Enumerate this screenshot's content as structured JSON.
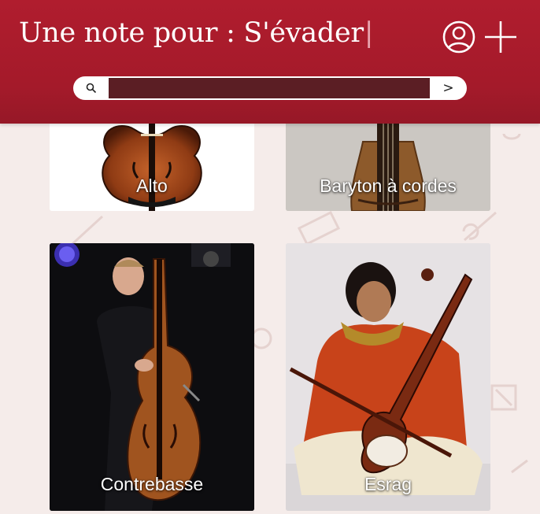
{
  "header": {
    "title": "Une note pour : S'évader",
    "cursor": "|",
    "user_icon": "user-circle-icon",
    "add_icon": "plus-icon"
  },
  "search": {
    "icon": "search-icon",
    "value": "",
    "placeholder": "",
    "go_label": ">"
  },
  "instruments": [
    {
      "name": "Alto",
      "icon": "viola-image"
    },
    {
      "name": "Baryton à cordes",
      "icon": "baryton-image"
    },
    {
      "name": "Contrebasse",
      "icon": "double-bass-player-image"
    },
    {
      "name": "Esrag",
      "icon": "esraj-player-image"
    }
  ],
  "colors": {
    "header": "#a81b2c",
    "background": "#f5ecea",
    "search_field": "#5b1e24"
  }
}
